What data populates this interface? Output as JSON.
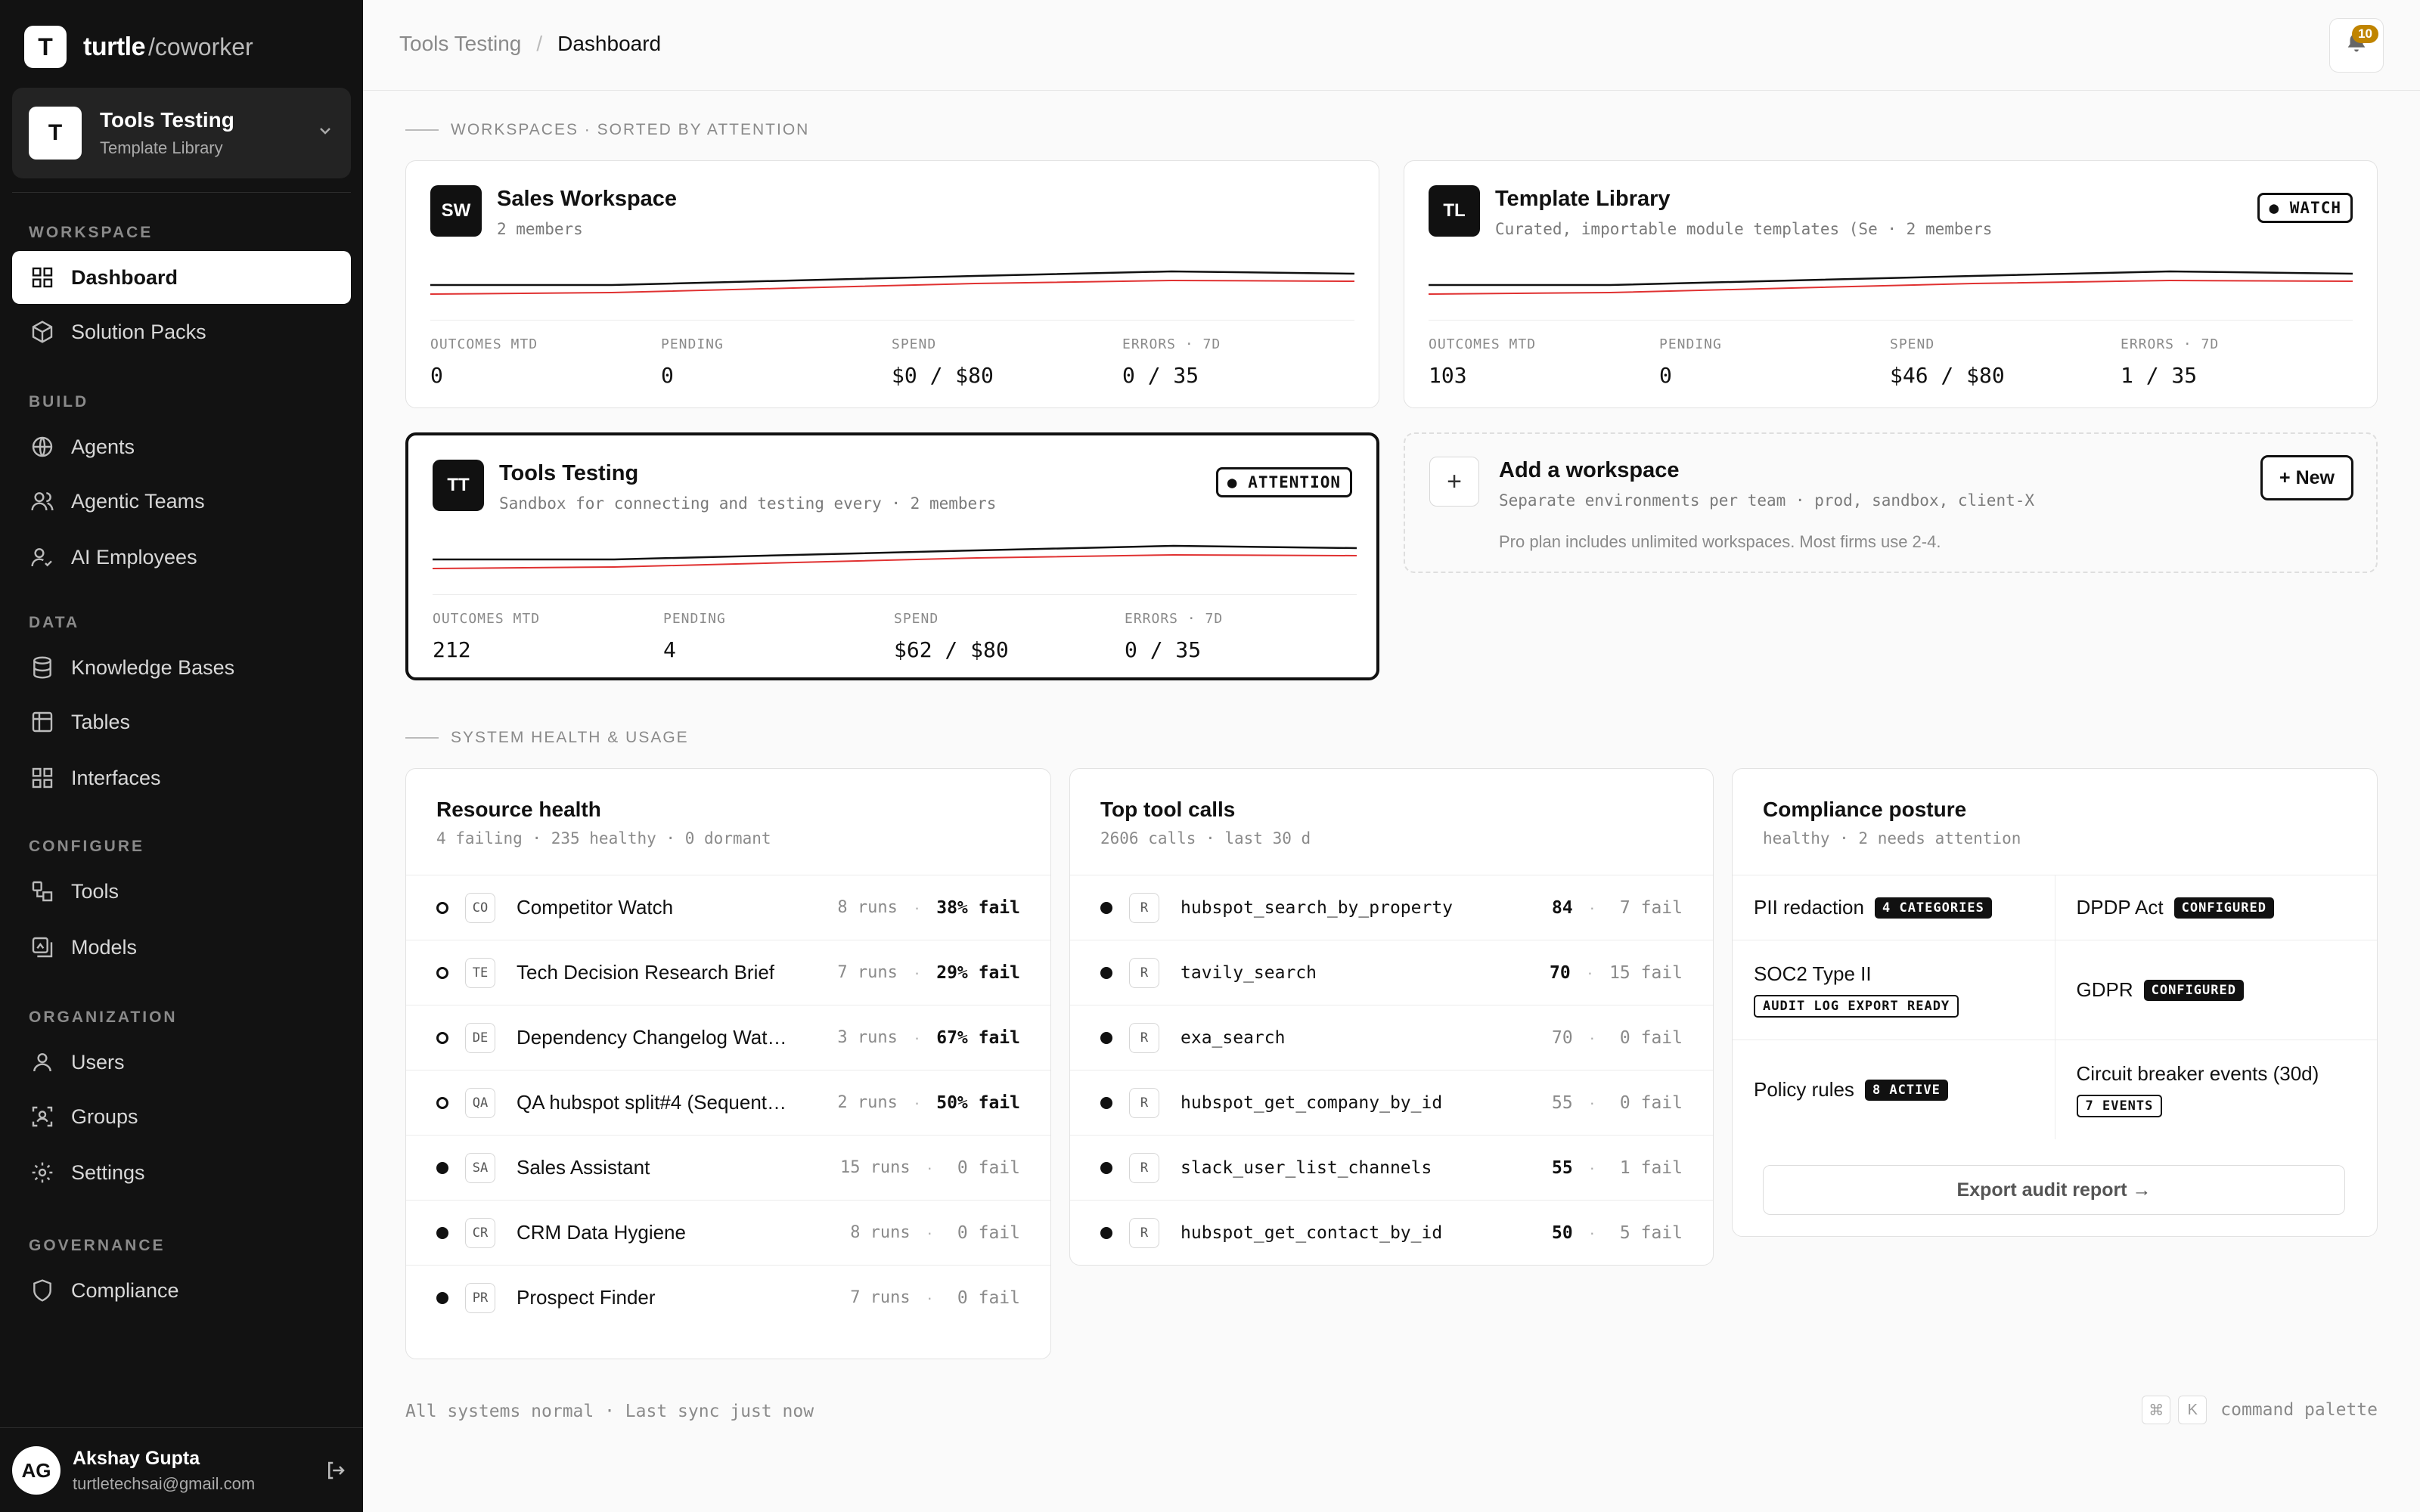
{
  "brand": {
    "logo_letter": "T",
    "name": "turtle",
    "suffix": "/coworker"
  },
  "workspace_switcher": {
    "avatar": "T",
    "title": "Tools Testing",
    "subtitle": "Template Library",
    "icon": "chevron-down-icon"
  },
  "sidebar": {
    "sections": [
      {
        "label": "WORKSPACE",
        "items": [
          {
            "label": "Dashboard",
            "icon": "grid-icon",
            "active": true
          },
          {
            "label": "Solution Packs",
            "icon": "box-icon"
          }
        ]
      },
      {
        "label": "BUILD",
        "items": [
          {
            "label": "Agents",
            "icon": "globe-icon"
          },
          {
            "label": "Agentic Teams",
            "icon": "users-icon"
          },
          {
            "label": "AI Employees",
            "icon": "user-check-icon"
          }
        ]
      },
      {
        "label": "DATA",
        "items": [
          {
            "label": "Knowledge Bases",
            "icon": "database-icon"
          },
          {
            "label": "Tables",
            "icon": "table-icon"
          },
          {
            "label": "Interfaces",
            "icon": "layout-icon"
          }
        ]
      },
      {
        "label": "CONFIGURE",
        "items": [
          {
            "label": "Tools",
            "icon": "tools-icon"
          },
          {
            "label": "Models",
            "icon": "model-icon"
          }
        ]
      },
      {
        "label": "ORGANIZATION",
        "items": [
          {
            "label": "Users",
            "icon": "user-icon"
          },
          {
            "label": "Groups",
            "icon": "groups-icon"
          },
          {
            "label": "Settings",
            "icon": "gear-icon"
          }
        ]
      },
      {
        "label": "GOVERNANCE",
        "items": [
          {
            "label": "Compliance",
            "icon": "shield-icon"
          }
        ]
      }
    ]
  },
  "user": {
    "initials": "AG",
    "name": "Akshay Gupta",
    "email": "turtletechsai@gmail.com"
  },
  "header": {
    "breadcrumb": [
      "Tools Testing",
      "Dashboard"
    ],
    "notification_count": "10"
  },
  "workspaces_section": {
    "title": "WORKSPACES · SORTED BY ATTENTION"
  },
  "metric_labels": {
    "outcomes": "OUTCOMES MTD",
    "pending": "PENDING",
    "spend": "SPEND",
    "errors": "ERRORS · 7D"
  },
  "workspaces": [
    {
      "avatar": "SW",
      "name": "Sales Workspace",
      "desc": "2 members",
      "badge": "",
      "outcomes": "0",
      "pending": "0",
      "spend": "$0 / $80",
      "errors": "0 / 35"
    },
    {
      "avatar": "TL",
      "name": "Template Library",
      "desc": "Curated, importable module templates (Se · 2 members",
      "badge": "● WATCH",
      "outcomes": "103",
      "pending": "0",
      "spend": "$46 / $80",
      "errors": "1 / 35"
    },
    {
      "avatar": "TT",
      "name": "Tools Testing",
      "desc": "Sandbox for connecting and testing every · 2 members",
      "badge": "● ATTENTION",
      "outcomes": "212",
      "pending": "4",
      "spend": "$62 / $80",
      "errors": "0 / 35"
    }
  ],
  "add_workspace": {
    "title": "Add a workspace",
    "desc": "Separate environments per team · prod, sandbox, client-X",
    "note": "Pro plan includes unlimited workspaces. Most firms use 2-4.",
    "button": "+ New"
  },
  "health_section": {
    "title": "SYSTEM HEALTH & USAGE"
  },
  "resource_health": {
    "title": "Resource health",
    "subtitle": "4 failing · 235 healthy · 0 dormant",
    "rows": [
      {
        "code": "CO",
        "name": "Competitor Watch",
        "runs": "8 runs",
        "fail": "38% fail",
        "failing": true
      },
      {
        "code": "TE",
        "name": "Tech Decision Research Brief",
        "runs": "7 runs",
        "fail": "29% fail",
        "failing": true
      },
      {
        "code": "DE",
        "name": "Dependency Changelog Wat…",
        "runs": "3 runs",
        "fail": "67% fail",
        "failing": true
      },
      {
        "code": "QA",
        "name": "QA hubspot split#4 (Sequent…",
        "runs": "2 runs",
        "fail": "50% fail",
        "failing": true
      },
      {
        "code": "SA",
        "name": "Sales Assistant",
        "runs": "15 runs",
        "fail": "0 fail",
        "failing": false
      },
      {
        "code": "CR",
        "name": "CRM Data Hygiene",
        "runs": "8 runs",
        "fail": "0 fail",
        "failing": false
      },
      {
        "code": "PR",
        "name": "Prospect Finder",
        "runs": "7 runs",
        "fail": "0 fail",
        "failing": false
      }
    ]
  },
  "top_tools": {
    "title": "Top tool calls",
    "subtitle": "2606 calls · last 30 d",
    "rows": [
      {
        "code": "R",
        "name": "hubspot_search_by_property",
        "count": "84",
        "fail": "7 fail",
        "emph": true
      },
      {
        "code": "R",
        "name": "tavily_search",
        "count": "70",
        "fail": "15 fail",
        "emph": true
      },
      {
        "code": "R",
        "name": "exa_search",
        "count": "70",
        "fail": "0 fail",
        "emph": false
      },
      {
        "code": "R",
        "name": "hubspot_get_company_by_id",
        "count": "55",
        "fail": "0 fail",
        "emph": false
      },
      {
        "code": "R",
        "name": "slack_user_list_channels",
        "count": "55",
        "fail": "1 fail",
        "emph": true
      },
      {
        "code": "R",
        "name": "hubspot_get_contact_by_id",
        "count": "50",
        "fail": "5 fail",
        "emph": true
      }
    ]
  },
  "compliance": {
    "title": "Compliance posture",
    "subtitle": "healthy · 2 needs attention",
    "items": [
      {
        "label": "PII redaction",
        "tag": "4 CATEGORIES",
        "style": "dark"
      },
      {
        "label": "DPDP Act",
        "tag": "CONFIGURED",
        "style": "dark"
      },
      {
        "label": "SOC2 Type II",
        "tag": "AUDIT LOG EXPORT READY",
        "style": "outline"
      },
      {
        "label": "GDPR",
        "tag": "CONFIGURED",
        "style": "dark"
      },
      {
        "label": "Policy rules",
        "tag": "8 ACTIVE",
        "style": "dark"
      },
      {
        "label": "Circuit breaker events (30d)",
        "tag": "7 EVENTS",
        "style": "outline"
      }
    ],
    "export_button": "Export audit report →"
  },
  "footer": {
    "status": "All systems normal · Last sync just now",
    "kbd1": "⌘",
    "kbd2": "K",
    "hint": "command palette"
  }
}
